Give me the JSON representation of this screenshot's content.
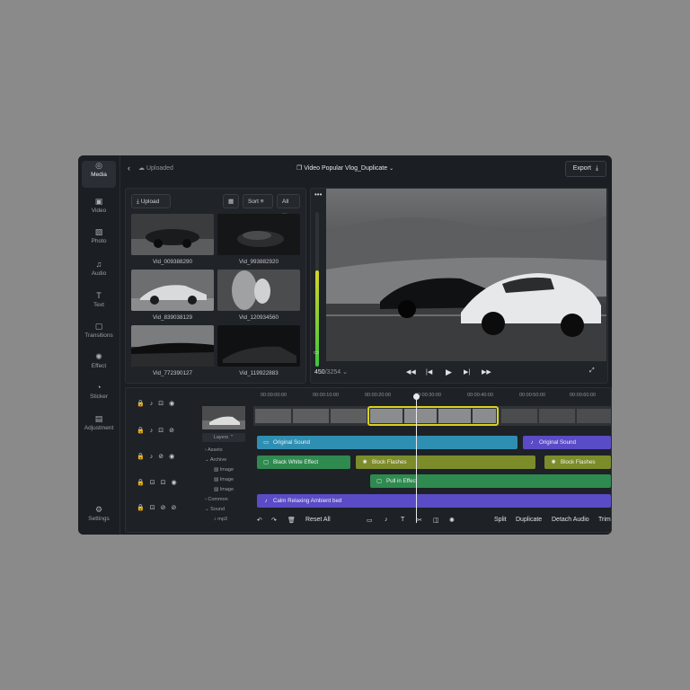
{
  "nav": {
    "items": [
      {
        "label": "Media",
        "icon": "media-icon",
        "glyph": "◎"
      },
      {
        "label": "Video",
        "icon": "video-icon",
        "glyph": "▣"
      },
      {
        "label": "Photo",
        "icon": "photo-icon",
        "glyph": "▨"
      },
      {
        "label": "Audio",
        "icon": "audio-icon",
        "glyph": "♫"
      },
      {
        "label": "Text",
        "icon": "text-icon",
        "glyph": "T"
      },
      {
        "label": "Transitions",
        "icon": "transitions-icon",
        "glyph": "▢"
      },
      {
        "label": "Effect",
        "icon": "effect-icon",
        "glyph": "✺"
      },
      {
        "label": "Sticker",
        "icon": "sticker-icon",
        "glyph": "◔"
      },
      {
        "label": "Adjustment",
        "icon": "adjustment-icon",
        "glyph": "▤"
      }
    ],
    "settings": "Settings"
  },
  "header": {
    "back": "‹",
    "status": "Uploaded",
    "title": "Video Popular Vlog_Duplicate",
    "export": "Export"
  },
  "media": {
    "upload": "Upload",
    "sort": "Sort",
    "filter": "All",
    "items": [
      "Vid_009388290",
      "Vid_993882920",
      "Vid_839038129",
      "Vid_120934560",
      "Vid_772390127",
      "Vid_119922883"
    ]
  },
  "preview": {
    "frame_current": "450",
    "frame_total": "/3254",
    "audio_level": 0.62
  },
  "timeline": {
    "ruler": [
      "00:00:00:00",
      "00:00:10:00",
      "00:00:20:00",
      "00:00:30:00",
      "00:00:40:00",
      "00:00:50:00",
      "00:00:60:00"
    ],
    "layers_label": "Layers",
    "tree": [
      "Assets",
      "Archive",
      "Image",
      "Image",
      "Image",
      "Common",
      "Sound",
      "mp3"
    ],
    "clips": {
      "original_sound_1": "Original Sound",
      "original_sound_2": "Original Sound",
      "bw_effect": "Black White Effect",
      "block_flashes_1": "Block Flashes",
      "block_flashes_2": "Block Flashes",
      "pull_in": "Pull in Effect",
      "ambient": "Calm Relaxing Ambient bed"
    },
    "tools": {
      "reset": "Reset All",
      "split": "Split",
      "duplicate": "Duplicate",
      "detach": "Detach Audio",
      "trim": "Trim"
    }
  },
  "colors": {
    "accent_yellow": "#d9d21e",
    "blue_track": "#2e8fb3",
    "purple_track": "#5a4bc7",
    "green_track": "#2f8a4f",
    "olive_track": "#7c8c2a"
  }
}
